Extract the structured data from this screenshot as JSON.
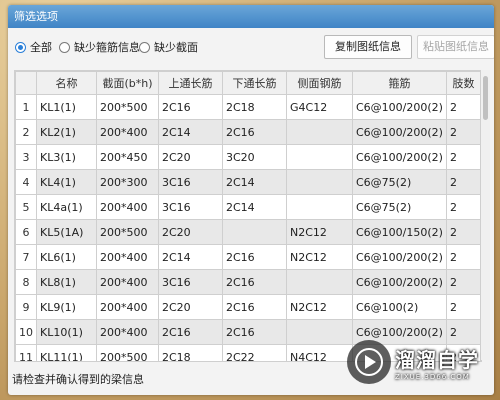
{
  "window": {
    "title": "筛选选项"
  },
  "filters": {
    "options": [
      {
        "label": "全部",
        "selected": true
      },
      {
        "label": "缺少箍筋信息",
        "selected": false
      },
      {
        "label": "缺少截面",
        "selected": false
      }
    ],
    "copy_button": "复制图纸信息",
    "paste_button": "粘贴图纸信息"
  },
  "table": {
    "columns": [
      "",
      "名称",
      "截面(b*h)",
      "上通长筋",
      "下通长筋",
      "侧面钢筋",
      "箍筋",
      "肢数"
    ],
    "rows": [
      {
        "no": "1",
        "cells": [
          "KL1(1)",
          "200*500",
          "2C16",
          "2C18",
          "G4C12",
          "C6@100/200(2)",
          "2"
        ]
      },
      {
        "no": "2",
        "cells": [
          "KL2(1)",
          "200*400",
          "2C14",
          "2C16",
          "",
          "C6@100/200(2)",
          "2"
        ]
      },
      {
        "no": "3",
        "cells": [
          "KL3(1)",
          "200*450",
          "2C20",
          "3C20",
          "",
          "C6@100/200(2)",
          "2"
        ]
      },
      {
        "no": "4",
        "cells": [
          "KL4(1)",
          "200*300",
          "3C16",
          "2C14",
          "",
          "C6@75(2)",
          "2"
        ]
      },
      {
        "no": "5",
        "cells": [
          "KL4a(1)",
          "200*400",
          "3C16",
          "2C14",
          "",
          "C6@75(2)",
          "2"
        ]
      },
      {
        "no": "6",
        "cells": [
          "KL5(1A)",
          "200*500",
          "2C20",
          "",
          "N2C12",
          "C6@100/150(2)",
          "2"
        ]
      },
      {
        "no": "7",
        "cells": [
          "KL6(1)",
          "200*400",
          "2C14",
          "2C16",
          "N2C12",
          "C6@100/200(2)",
          "2"
        ]
      },
      {
        "no": "8",
        "cells": [
          "KL8(1)",
          "200*400",
          "3C16",
          "2C16",
          "",
          "C6@100/200(2)",
          "2"
        ]
      },
      {
        "no": "9",
        "cells": [
          "KL9(1)",
          "200*400",
          "2C20",
          "2C16",
          "N2C12",
          "C6@100(2)",
          "2"
        ]
      },
      {
        "no": "10",
        "cells": [
          "KL10(1)",
          "200*400",
          "2C16",
          "2C16",
          "",
          "C6@100/200(2)",
          "2"
        ]
      },
      {
        "no": "11",
        "cells": [
          "KL11(1)",
          "200*500",
          "2C18",
          "2C22",
          "N4C12",
          "",
          "2"
        ]
      }
    ]
  },
  "status_text": "请检查并确认得到的梁信息",
  "watermark": {
    "title": "溜溜自学",
    "url": "ZIXUE.3D66.COM"
  },
  "colors": {
    "accent": "#2a7fd8",
    "titlebar": "#4a8fd0",
    "shaded": "#e8e8e8"
  }
}
